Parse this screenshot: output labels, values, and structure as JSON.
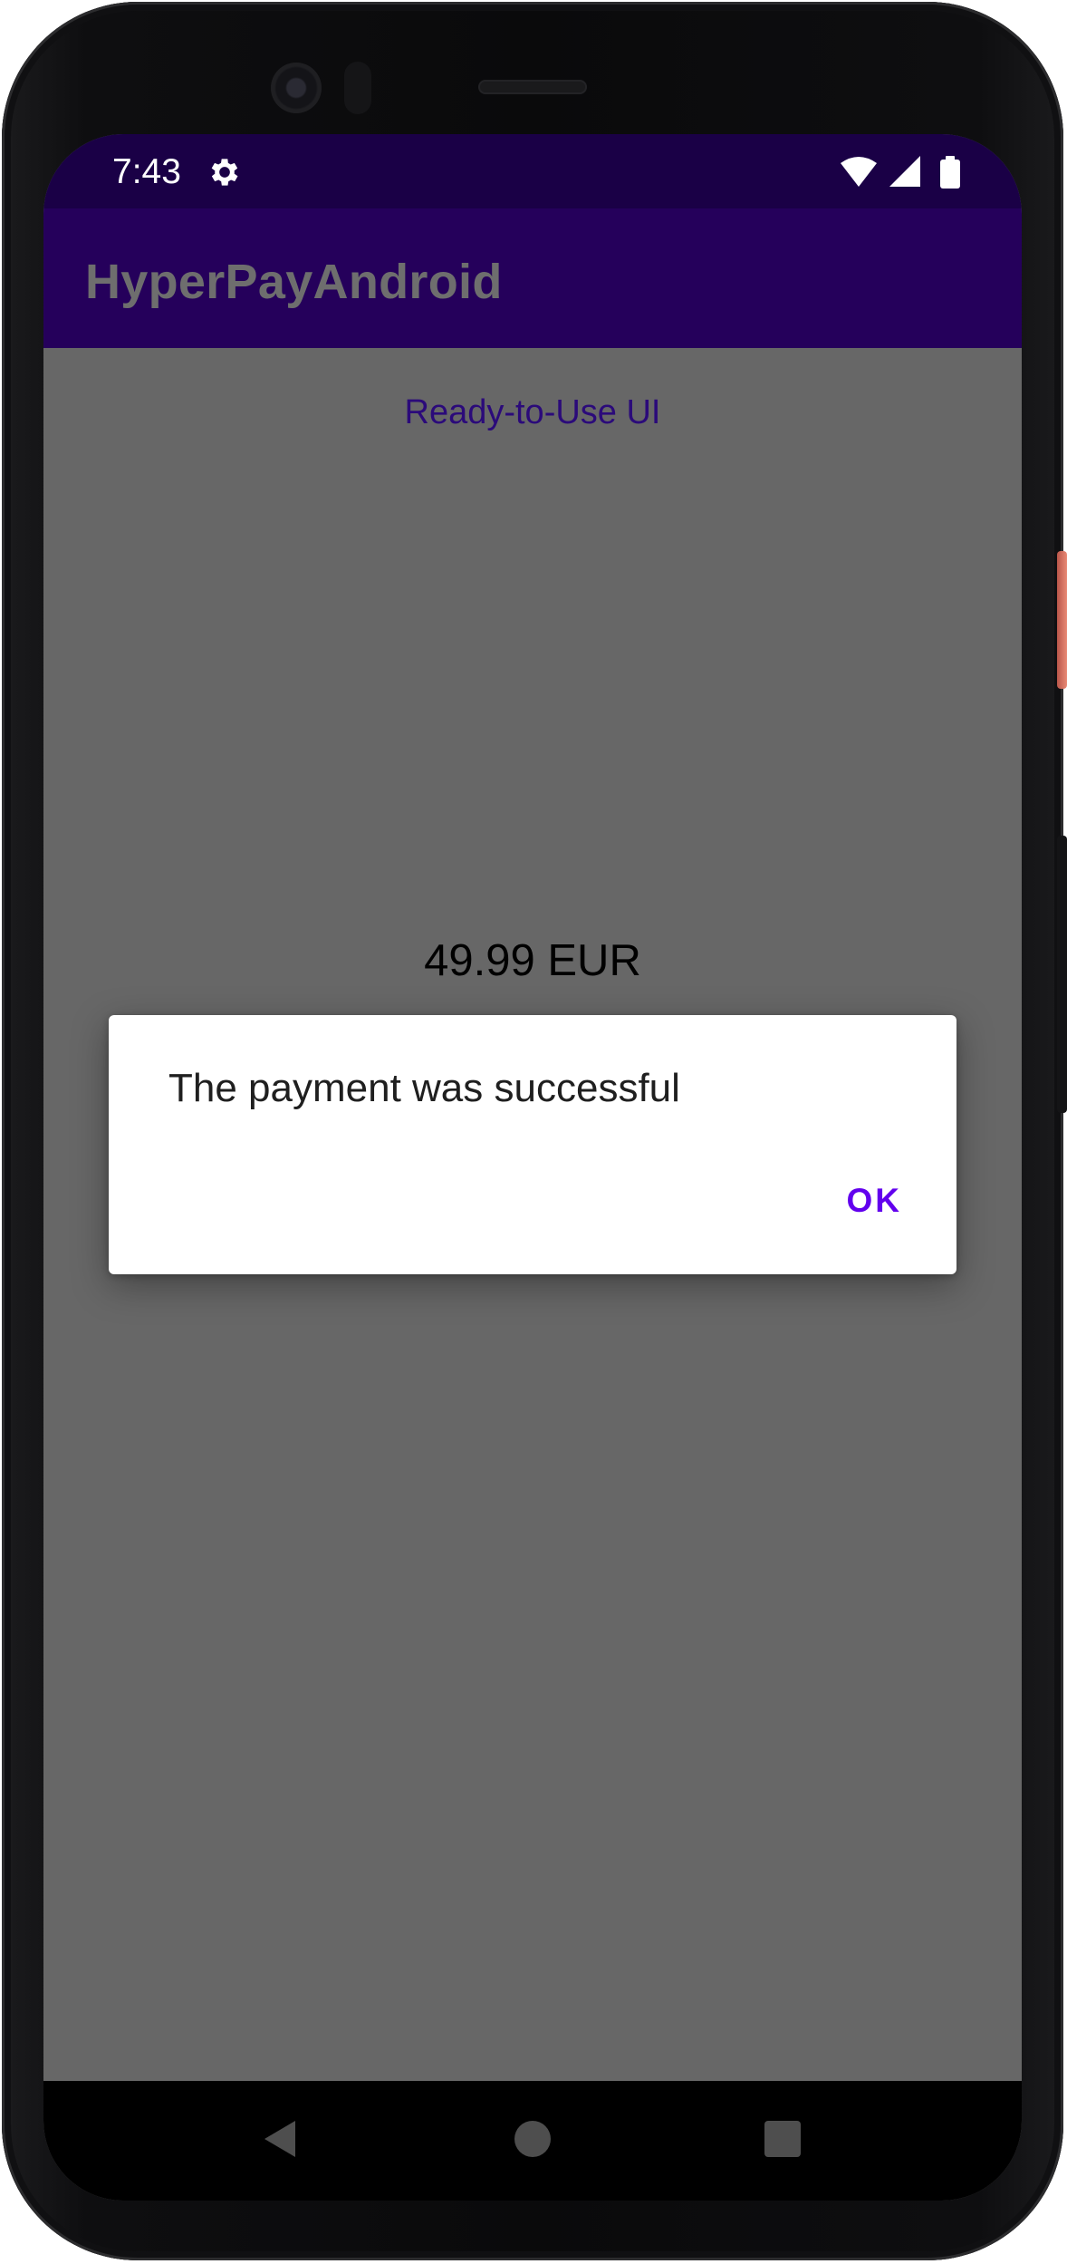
{
  "status_bar": {
    "time": "7:43",
    "icons": [
      "settings-icon",
      "wifi-icon",
      "signal-icon",
      "battery-icon"
    ]
  },
  "app_bar": {
    "title": "HyperPayAndroid"
  },
  "main": {
    "link_label": "Ready-to-Use UI",
    "amount": "49.99 EUR"
  },
  "dialog": {
    "message": "The payment was successful",
    "ok_label": "OK"
  },
  "navigation": {
    "buttons": [
      "back-icon",
      "home-icon",
      "recents-icon"
    ]
  },
  "colors": {
    "status_bar": "#1a0046",
    "app_bar": "#25005b",
    "scrim_background": "#676767",
    "accent": "#6200ee",
    "device_frame_button": "#e98a76"
  }
}
